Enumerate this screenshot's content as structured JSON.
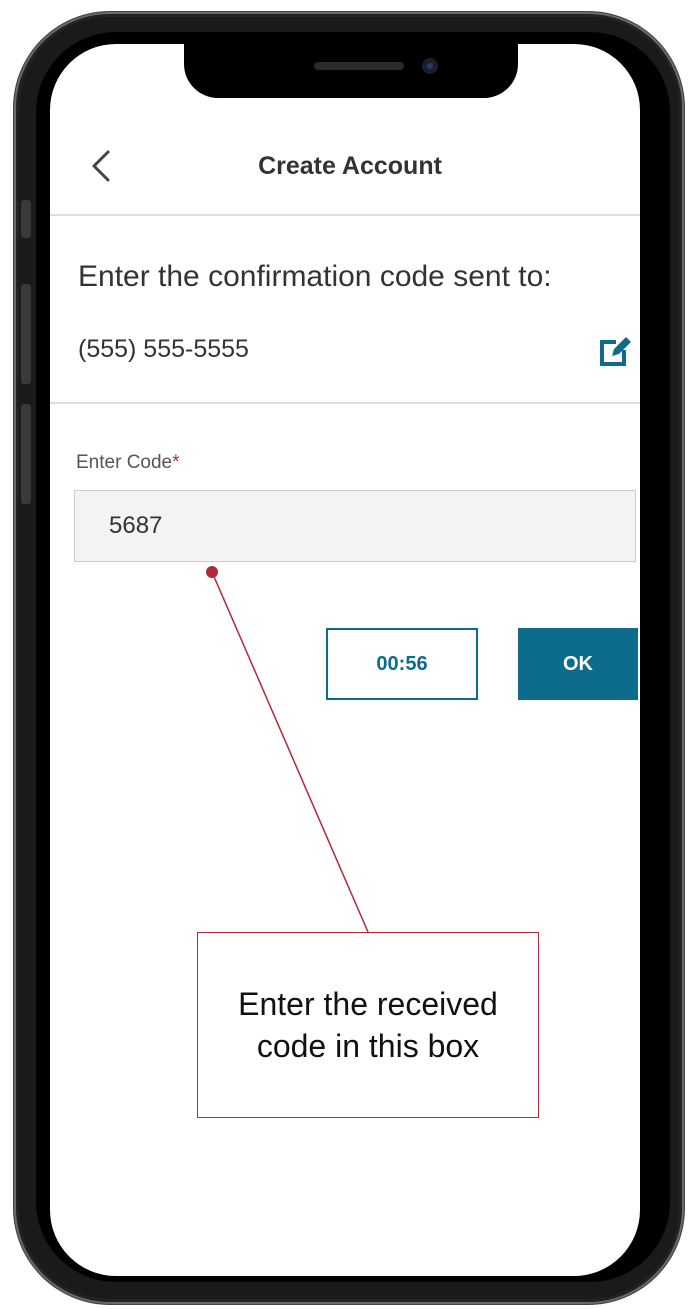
{
  "header": {
    "title": "Create Account",
    "back_icon": "chevron-left-icon"
  },
  "confirmation": {
    "prompt": "Enter the confirmation code sent to:",
    "phone_number": "(555) 555-5555",
    "edit_icon": "edit-icon"
  },
  "code_field": {
    "label": "Enter Code",
    "required_marker": "*",
    "value": "5687"
  },
  "actions": {
    "timer_label": "00:56",
    "ok_label": "OK"
  },
  "annotation": {
    "text": "Enter the received code in this box"
  },
  "colors": {
    "accent": "#0d6b8c",
    "required": "#c0273d",
    "annotation": "#b02a3a"
  }
}
